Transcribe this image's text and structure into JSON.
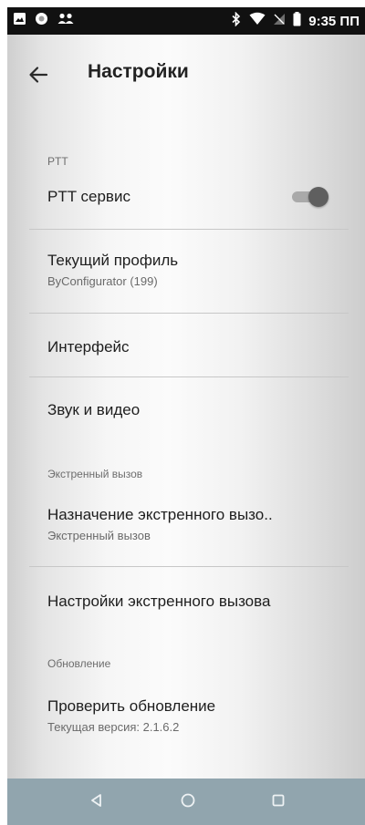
{
  "status_bar": {
    "time": "9:35 ПП",
    "icons_left": [
      "image-icon",
      "circle-notification-icon",
      "group-icon"
    ],
    "icons_right": [
      "bluetooth-icon",
      "wifi-icon",
      "no-sim-icon",
      "battery-icon"
    ]
  },
  "app_bar": {
    "title": "Настройки",
    "back_icon": "arrow-back-icon"
  },
  "sections": {
    "ptt": {
      "header": "PTT",
      "service": {
        "title": "PTT сервис",
        "toggle_on": true
      },
      "profile": {
        "title": "Текущий профиль",
        "summary": "ByConfigurator (199)"
      },
      "interface": {
        "title": "Интерфейс"
      },
      "sound_video": {
        "title": "Звук и видео"
      }
    },
    "emergency": {
      "header": "Экстренный вызов",
      "assignment": {
        "title": "Назначение экстренного вызо..",
        "summary": "Экстренный вызов"
      },
      "settings": {
        "title": "Настройки экстренного вызова"
      }
    },
    "update": {
      "header": "Обновление",
      "check": {
        "title": "Проверить обновление",
        "summary": "Текущая версия: 2.1.6.2"
      }
    }
  },
  "nav_bar": {
    "buttons": [
      "back-triangle-icon",
      "home-circle-icon",
      "recents-square-icon"
    ],
    "color": "#91a5ae"
  },
  "colors": {
    "accent_toggle_thumb": "#5f5f5f",
    "toggle_track": "#a9a9a9",
    "status_bar": "#111111"
  }
}
